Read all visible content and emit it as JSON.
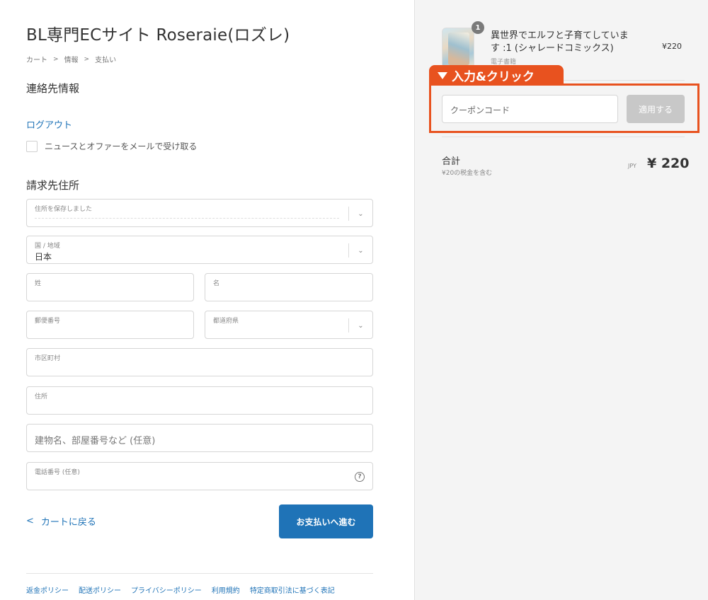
{
  "header": {
    "shop_title": "BL専門ECサイト Roseraie(ロズレ)",
    "breadcrumb": [
      "カート",
      "情報",
      "支払い"
    ]
  },
  "contact": {
    "section_title": "連絡先情報",
    "logout_label": "ログアウト",
    "newsletter_label": "ニュースとオファーをメールで受け取る",
    "newsletter_checked": false
  },
  "billing": {
    "section_title": "請求先住所",
    "saved_address": {
      "label": "住所を保存しました"
    },
    "country": {
      "label": "国 / 地域",
      "value": "日本"
    },
    "last_name": {
      "label": "姓"
    },
    "first_name": {
      "label": "名"
    },
    "postal_code": {
      "label": "郵便番号"
    },
    "prefecture": {
      "label": "都道府県"
    },
    "city": {
      "label": "市区町村"
    },
    "address": {
      "label": "住所"
    },
    "building": {
      "placeholder": "建物名、部屋番号など (任意)"
    },
    "phone": {
      "label": "電話番号 (任意)"
    }
  },
  "actions": {
    "back_label": "カートに戻る",
    "pay_label": "お支払いへ進む"
  },
  "footer": {
    "links": [
      "返金ポリシー",
      "配送ポリシー",
      "プライバシーポリシー",
      "利用規約",
      "特定商取引法に基づく表記"
    ]
  },
  "order_summary": {
    "item": {
      "quantity": "1",
      "name": "異世界でエルフと子育てしていま す :1 (シャレードコミックス)",
      "subtitle": "電子書籍",
      "price": "¥220"
    },
    "callout_label": "入力&クリック",
    "coupon": {
      "placeholder": "クーポンコード",
      "apply_label": "適用する"
    },
    "total": {
      "label": "合計",
      "tax_note": "¥20の税金を含む",
      "currency": "JPY",
      "amount": "¥ 220"
    }
  },
  "colors": {
    "accent_blue": "#1f73b7",
    "highlight_orange": "#e8521f",
    "sidebar_bg": "#f4f4f4"
  }
}
